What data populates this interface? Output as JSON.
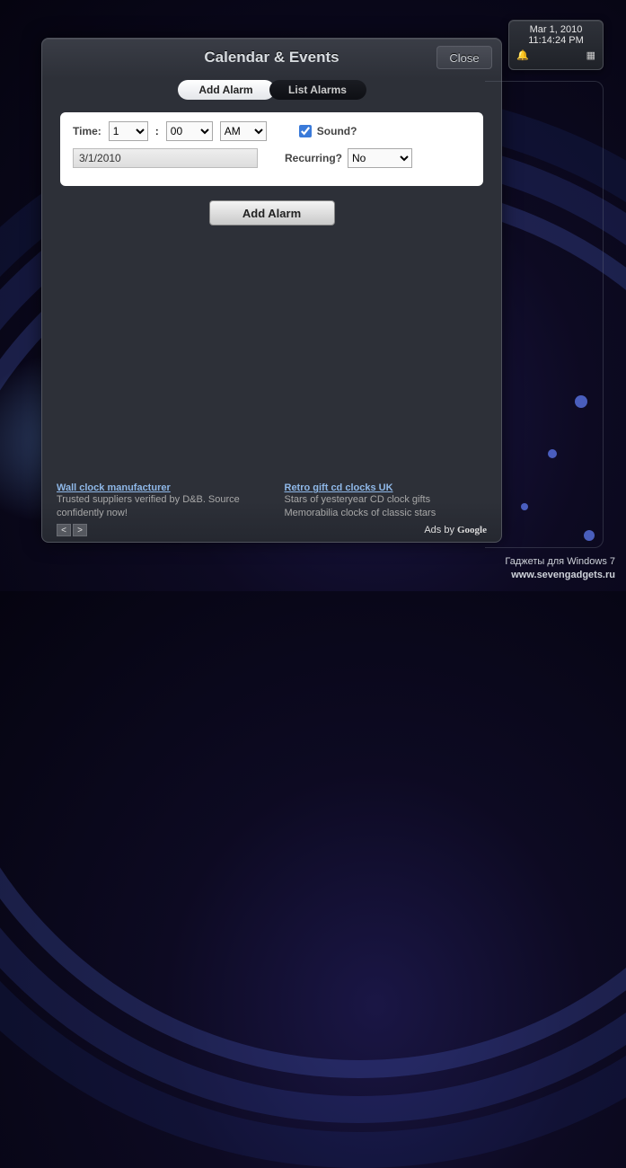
{
  "panel": {
    "title": "Calendar & Events",
    "close_label": "Close",
    "tabs": {
      "add": "Add Alarm",
      "list": "List Alarms"
    },
    "form": {
      "time_label": "Time:",
      "hour_value": "1",
      "minute_value": "00",
      "ampm_value": "AM",
      "colon": ":",
      "sound_label": "Sound?",
      "sound_checked": true,
      "date_value": "3/1/2010",
      "recurring_label": "Recurring?",
      "recurring_value": "No"
    },
    "add_button": "Add Alarm"
  },
  "ads": {
    "items": [
      {
        "title": "Wall clock manufacturer",
        "desc": "Trusted suppliers verified by D&B. Source confidently now!"
      },
      {
        "title": "Retro gift cd clocks UK",
        "desc": "Stars of yesteryear CD clock gifts Memorabilia clocks of classic stars"
      }
    ],
    "prev": "<",
    "next": ">",
    "byline_prefix": "Ads by ",
    "byline_brand": "Google"
  },
  "clock": {
    "date": "Mar 1, 2010",
    "time": "11:14:24 PM"
  },
  "watermark": {
    "line1": "Гаджеты для Windows 7",
    "line2": "www.sevengadgets.ru"
  }
}
